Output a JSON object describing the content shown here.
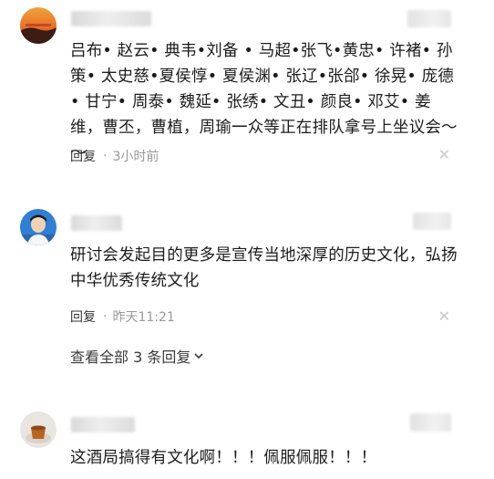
{
  "comments": [
    {
      "text": "吕布• 赵云• 典韦•刘备 • 马超•张飞•黄忠• 许褚• 孙策• 太史慈•夏侯惇• 夏侯渊• 张辽•张郃• 徐晃• 庞德• 甘宁• 周泰• 魏延• 张绣• 文丑• 颜良• 邓艾• 姜维，曹丕，曹植，周瑜一众等正在排队拿号上坐议会～～",
      "reply_label": "回复",
      "separator": "·",
      "time": "3小时前"
    },
    {
      "text": "研讨会发起目的更多是宣传当地深厚的历史文化，弘扬中华优秀传统文化",
      "reply_label": "回复",
      "separator": "·",
      "time": "昨天11:21"
    },
    {
      "text": "这酒局搞得有文化啊！！！佩服佩服！！！"
    }
  ],
  "view_all_replies": "查看全部 3 条回复",
  "icons": {
    "close": "close-icon",
    "chevron": "chevron-down-icon"
  }
}
